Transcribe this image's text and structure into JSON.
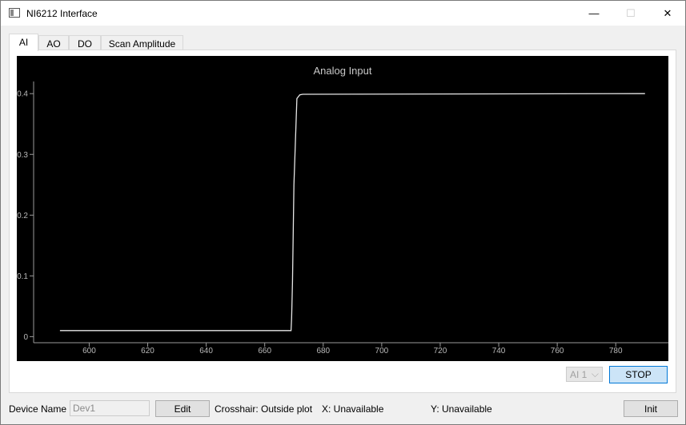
{
  "window": {
    "title": "NI6212 Interface",
    "min_label": "—",
    "max_label": "☐",
    "close_label": "✕"
  },
  "tabs": [
    {
      "label": "AI",
      "active": true
    },
    {
      "label": "AO",
      "active": false
    },
    {
      "label": "DO",
      "active": false
    },
    {
      "label": "Scan Amplitude",
      "active": false
    }
  ],
  "chart_data": {
    "type": "line",
    "title": "Analog Input",
    "xlabel": "",
    "ylabel": "",
    "xlim": [
      581,
      798
    ],
    "ylim": [
      -0.01,
      0.42
    ],
    "xticks": [
      600,
      620,
      640,
      660,
      680,
      700,
      720,
      740,
      760,
      780
    ],
    "yticks": [
      0,
      0.1,
      0.2,
      0.3,
      0.4
    ],
    "ytick_labels": [
      "0",
      "0.1",
      "0.2",
      "0.3",
      "0.4"
    ],
    "grid": false,
    "background": "#000000",
    "line_color": "#e6e6e6",
    "series": [
      {
        "x": [
          590,
          669,
          669.2,
          669.5,
          670,
          671,
          672,
          673,
          790
        ],
        "y": [
          0.01,
          0.01,
          0.03,
          0.09,
          0.25,
          0.392,
          0.398,
          0.399,
          0.4
        ]
      }
    ]
  },
  "controls": {
    "channel_select": {
      "value": "AI 1",
      "chevron": "⌵"
    },
    "stop_label": "STOP"
  },
  "status": {
    "device_name_label": "Device Name",
    "device_name_value": "Dev1",
    "edit_label": "Edit",
    "crosshair_text": "Crosshair: Outside plot",
    "x_text": "X: Unavailable",
    "y_text": "Y: Unavailable",
    "init_label": "Init"
  }
}
